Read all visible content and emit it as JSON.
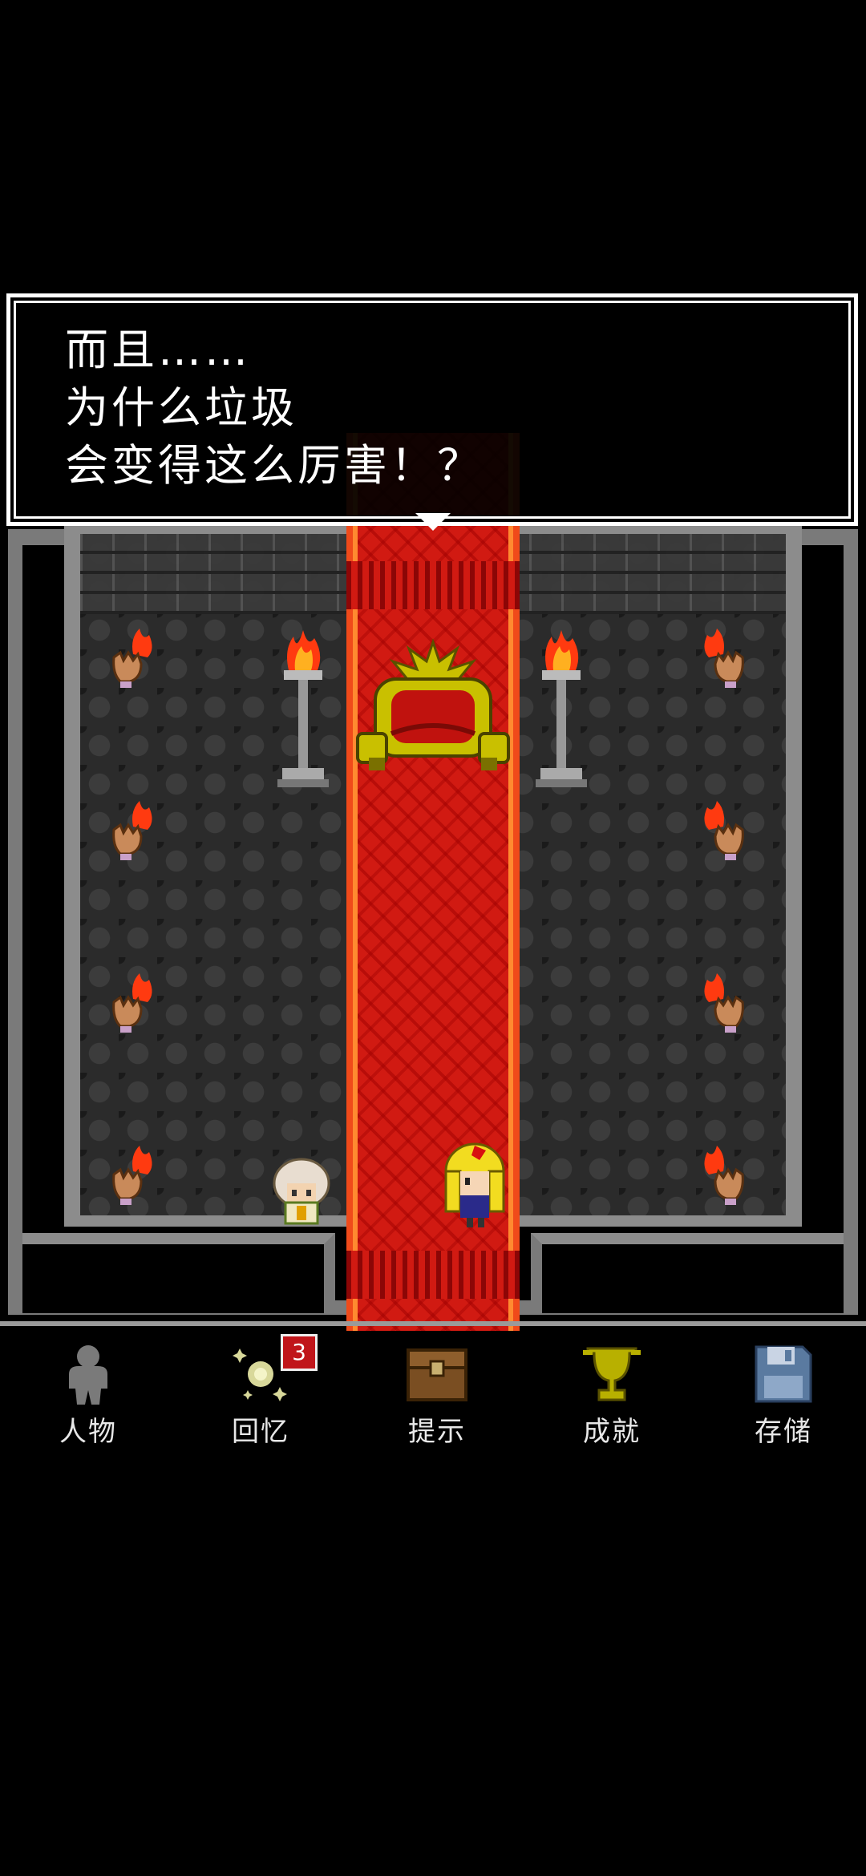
{
  "dialog": {
    "lines": [
      "而且……",
      "为什么垃圾",
      "会变得这么厉害！？"
    ]
  },
  "menu": {
    "items": [
      {
        "label": "人物",
        "icon": "character-icon"
      },
      {
        "label": "回忆",
        "icon": "memory-icon",
        "badge": "3"
      },
      {
        "label": "提示",
        "icon": "treasure-chest-icon"
      },
      {
        "label": "成就",
        "icon": "trophy-icon"
      },
      {
        "label": "存储",
        "icon": "floppy-disk-icon"
      }
    ]
  },
  "colors": {
    "carpet": "#d11a12",
    "wall": "#8c8c8c",
    "badge": "#c0151a",
    "throne": "#b8b000"
  }
}
